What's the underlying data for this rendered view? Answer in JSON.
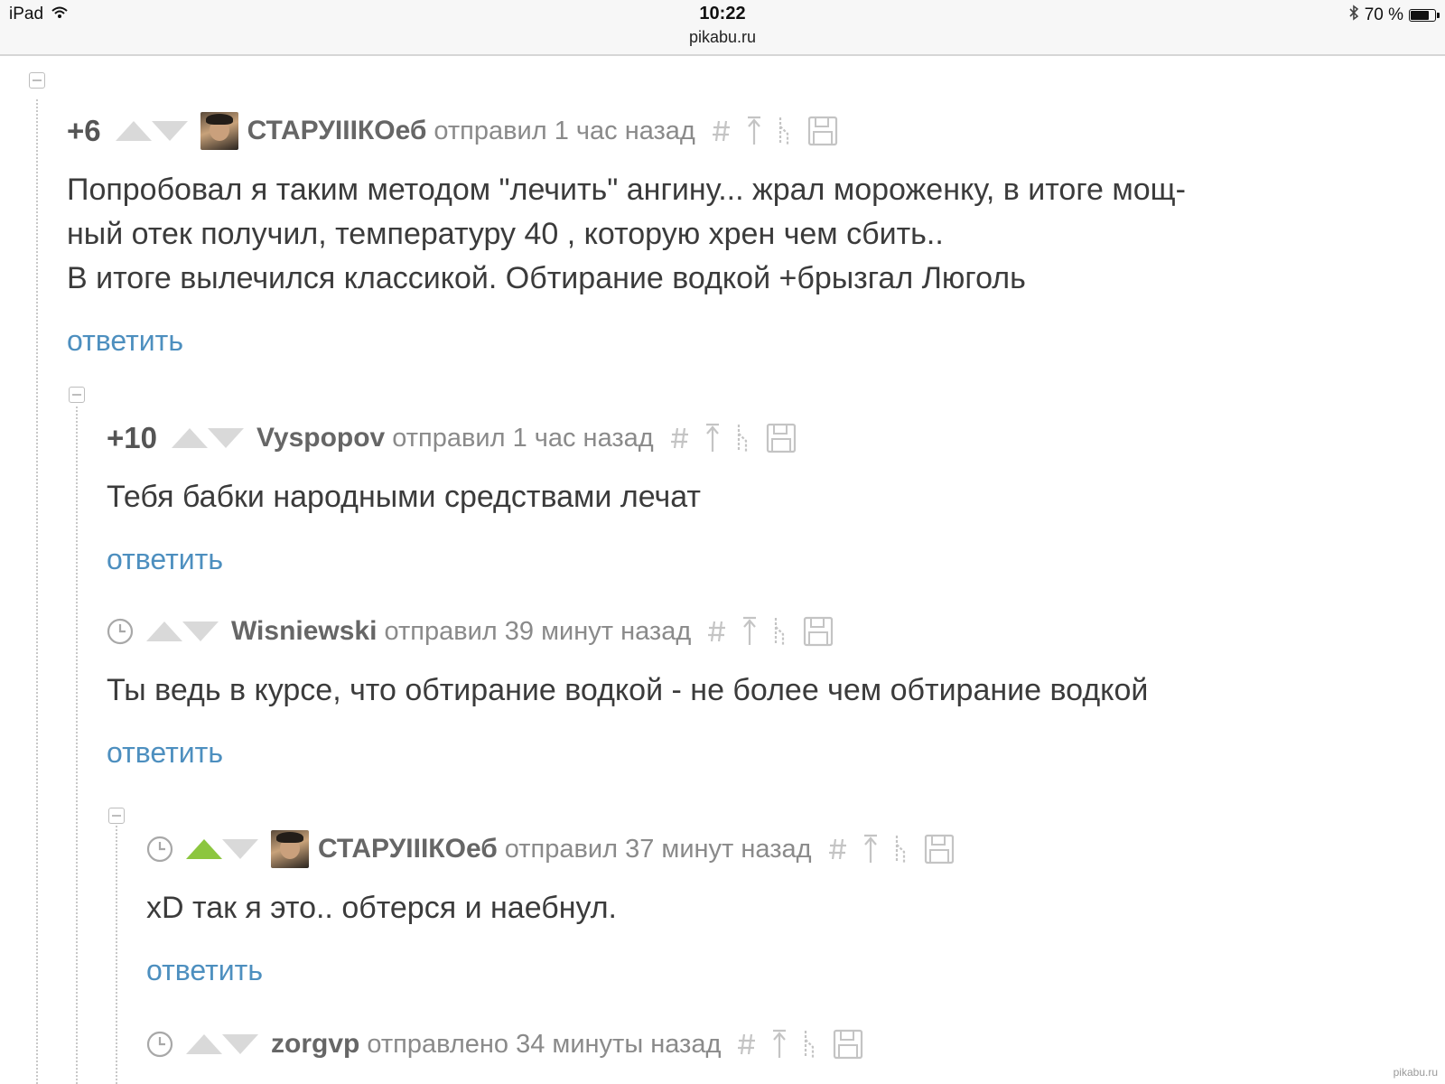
{
  "status_bar": {
    "device": "iPad",
    "time": "10:22",
    "url": "pikabu.ru",
    "battery": "70 %",
    "battery_level": 0.7
  },
  "comments": [
    {
      "rating": "+6",
      "author": "СТАРУIIIКОеб",
      "meta": "отправил 1 час назад",
      "lines": [
        "Попробовал я таким методом \"лечить\" ангину... жрал мороженку, в итоге мощ-",
        "ный отек получил, температуру 40 , которую хрен чем сбить..",
        "В итоге вылечился классикой. Обтирание водкой +брызгал Люголь"
      ],
      "reply": "ответить"
    },
    {
      "rating": "+10",
      "author": "Vyspopov",
      "meta": "отправил 1 час назад",
      "lines": [
        "Тебя бабки народными средствами лечат"
      ],
      "reply": "ответить"
    },
    {
      "author": "Wisniewski",
      "meta": "отправил 39 минут назад",
      "lines": [
        "Ты ведь в курсе, что обтирание водкой - не более чем обтирание водкой"
      ],
      "reply": "ответить"
    },
    {
      "author": "СТАРУIIIКОеб",
      "meta": "отправил 37 минут назад",
      "lines": [
        "xD так я это.. обтерся и наебнул."
      ],
      "reply": "ответить"
    },
    {
      "author": "zorgvp",
      "meta": "отправлено 34 минуты назад"
    }
  ],
  "watermark": "pikabu.ru"
}
